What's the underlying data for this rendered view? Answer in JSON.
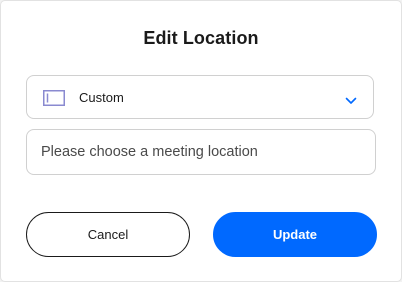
{
  "dialog": {
    "title": "Edit Location"
  },
  "location_select": {
    "selected_label": "Custom",
    "icon": "custom-location-icon",
    "chevron": "chevron-down-icon"
  },
  "location_input": {
    "placeholder": "Please choose a meeting location",
    "value": ""
  },
  "actions": {
    "cancel_label": "Cancel",
    "update_label": "Update"
  },
  "colors": {
    "primary": "#0069ff",
    "text": "#1a1a1a",
    "border": "#d0d0d0",
    "icon_accent": "#8a8ad0"
  }
}
